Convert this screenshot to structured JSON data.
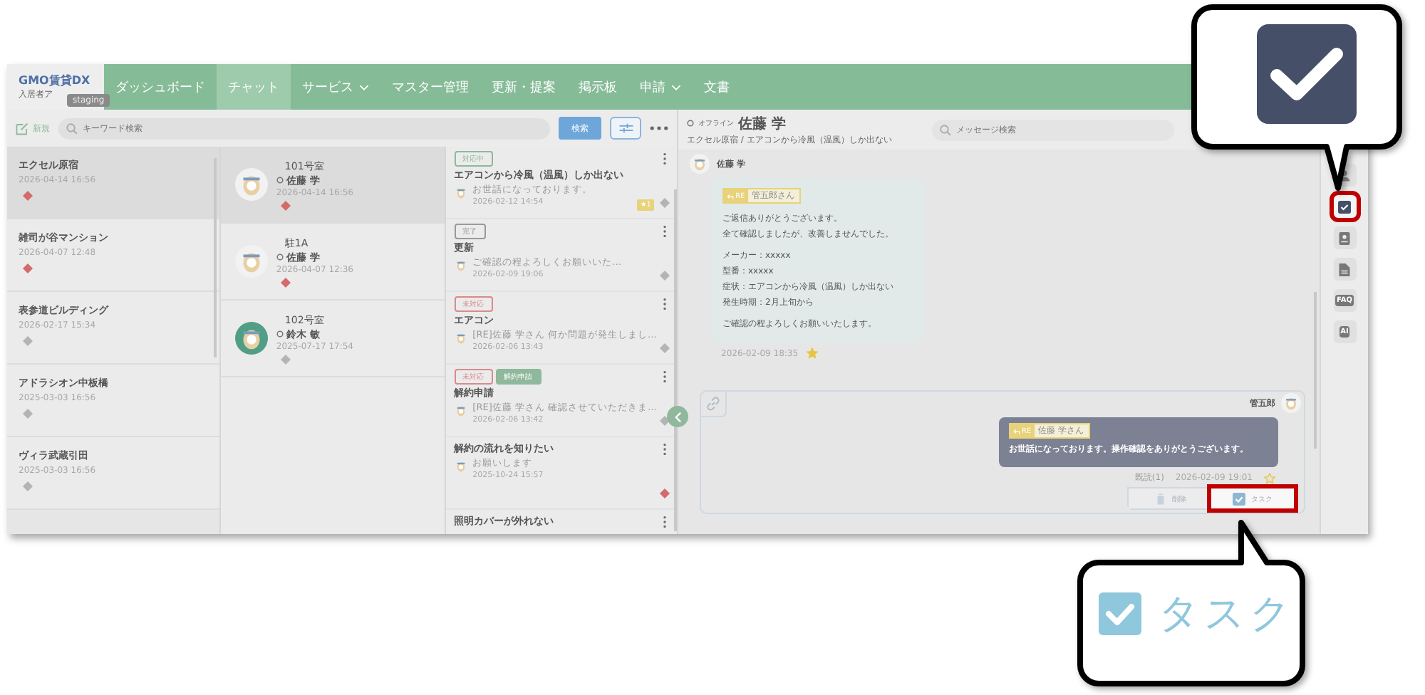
{
  "nav": {
    "logo": "GMO賃貸DX",
    "logo_sub": "入居者ア",
    "env_badge": "staging",
    "items": [
      {
        "label": "ダッシュボード",
        "selected": false,
        "dropdown": false
      },
      {
        "label": "チャット",
        "selected": true,
        "dropdown": false
      },
      {
        "label": "サービス",
        "selected": false,
        "dropdown": true
      },
      {
        "label": "マスター管理",
        "selected": false,
        "dropdown": false
      },
      {
        "label": "更新・提案",
        "selected": false,
        "dropdown": false
      },
      {
        "label": "掲示板",
        "selected": false,
        "dropdown": false
      },
      {
        "label": "申請",
        "selected": false,
        "dropdown": true
      },
      {
        "label": "文書",
        "selected": false,
        "dropdown": false
      }
    ]
  },
  "toolbar": {
    "new_label": "新規",
    "search_placeholder": "キーワード検索",
    "search_button": "検索"
  },
  "buildings": [
    {
      "name": "エクセル原宿",
      "date": "2026-04-14 16:56",
      "color": "#d46a6a",
      "selected": true
    },
    {
      "name": "雑司が谷マンション",
      "date": "2026-04-07 12:48",
      "color": "#d46a6a",
      "selected": false
    },
    {
      "name": "表参道ビルディング",
      "date": "2026-02-17 15:34",
      "color": "#b4b4b4",
      "selected": false
    },
    {
      "name": "アドラシオン中板橋",
      "date": "2025-03-03 16:56",
      "color": "#b4b4b4",
      "selected": false
    },
    {
      "name": "ヴィラ武蔵引田",
      "date": "2025-03-03 16:56",
      "color": "#b4b4b4",
      "selected": false
    }
  ],
  "rooms": [
    {
      "room": "101号室",
      "name": "佐藤 学",
      "date": "2026-04-14 16:56",
      "color": "#d46a6a",
      "kind": "plain",
      "selected": true
    },
    {
      "room": "駐1A",
      "name": "佐藤 学",
      "date": "2026-04-07 12:36",
      "color": "#d46a6a",
      "kind": "plain",
      "selected": false
    },
    {
      "room": "102号室",
      "name": "鈴木 敏",
      "date": "2025-07-17 17:54",
      "color": "#b4b4b4",
      "kind": "teal",
      "selected": false
    }
  ],
  "threads": [
    {
      "tags": [
        {
          "label": "対応中",
          "kind": "progress"
        }
      ],
      "title": "エアコンから冷風（温風）しか出ない",
      "preview": "お世話になっております。",
      "date": "2026-02-12 14:54",
      "badge": "★1",
      "color": "#b4b4b4"
    },
    {
      "tags": [
        {
          "label": "完了",
          "kind": "done"
        }
      ],
      "title": "更新",
      "preview": "ご確認の程よろしくお願いいた…",
      "date": "2026-02-09 19:06",
      "color": "#b4b4b4"
    },
    {
      "tags": [
        {
          "label": "未対応",
          "kind": "open"
        }
      ],
      "title": "エアコン",
      "preview": "[RE]佐藤 学さん 何か問題が発生しまし…",
      "date": "2026-02-06 13:43",
      "color": "#b4b4b4"
    },
    {
      "tags": [
        {
          "label": "未対応",
          "kind": "open"
        },
        {
          "label": "解約申請",
          "kind": "request"
        }
      ],
      "title": "解約申請",
      "preview": "[RE]佐藤 学さん 確認させていただきま…",
      "date": "2026-02-06 13:42",
      "color": "#b4b4b4"
    },
    {
      "title": "解約の流れを知りたい",
      "preview": "お願いします",
      "date": "2025-10-24 15:57",
      "color": "#d46a6a"
    },
    {
      "title": "照明カバーが外れない"
    }
  ],
  "chat": {
    "status": "オフライン",
    "name": "佐藤 学",
    "subtitle": "エクセル原宿 / エアコンから冷風（温風）しか出ない",
    "search_placeholder": "メッセージ検索",
    "incoming": {
      "sender": "佐藤 学",
      "reply_tag": "RE",
      "reply_to": "管五郎さん",
      "paragraphs": [
        [
          "ご返信ありがとうございます。",
          "全て確認しましたが、改善しませんでした。"
        ],
        [
          "メーカー：xxxxx",
          "型番：xxxxx",
          "症状：エアコンから冷風（温風）しか出ない",
          "発生時期：2月上旬から"
        ],
        [
          "ご確認の程よろしくお願いいたします。"
        ]
      ],
      "date": "2026-02-09 18:35",
      "starred": true
    },
    "outgoing": {
      "sender": "管五郎",
      "reply_tag": "RE",
      "reply_to": "佐藤 学さん",
      "text": "お世話になっております。操作確認をありがとうございます。",
      "read": "既読(1)",
      "date": "2026-02-09 19:01",
      "starred": false,
      "actions": [
        {
          "label": "削除",
          "kind": "delete",
          "highlighted": false
        },
        {
          "label": "タスク",
          "kind": "task",
          "highlighted": true
        }
      ]
    }
  },
  "sidebar_tools": [
    {
      "kind": "user",
      "highlighted": false
    },
    {
      "kind": "task",
      "highlighted": true
    },
    {
      "kind": "card",
      "highlighted": false
    },
    {
      "kind": "doc",
      "highlighted": false
    },
    {
      "kind": "faq",
      "label": "FAQ",
      "highlighted": false
    },
    {
      "kind": "ai",
      "label": "AI",
      "highlighted": false
    }
  ],
  "callouts": {
    "task_label": "タスク"
  }
}
